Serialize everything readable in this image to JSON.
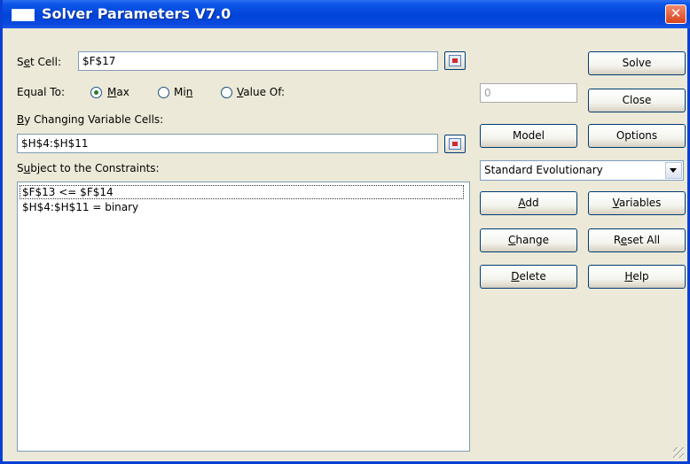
{
  "window": {
    "title": "Solver Parameters V7.0",
    "close_glyph": "✕"
  },
  "set_cell": {
    "label_pre": "S",
    "label_u": "e",
    "label_post": "t Cell:",
    "value": "$F$17"
  },
  "equal_to": {
    "label": "Equal To:",
    "options": [
      {
        "u": "M",
        "rest": "ax",
        "selected": true
      },
      {
        "pre": "Mi",
        "u": "n",
        "selected": false
      },
      {
        "pre": "",
        "u": "V",
        "rest": "alue Of:",
        "selected": false
      }
    ],
    "value_of": "0"
  },
  "changing_cells": {
    "label_u": "B",
    "label_post": "y Changing Variable Cells:",
    "value": "$H$4:$H$11"
  },
  "constraints": {
    "label_pre": "S",
    "label_u": "u",
    "label_post": "bject to the Constraints:",
    "items": [
      "$F$13 <= $F$14",
      "$H$4:$H$11 = binary"
    ]
  },
  "engine": {
    "selected": "Standard Evolutionary"
  },
  "buttons": {
    "solve": "Solve",
    "close": "Close",
    "model": "Model",
    "options": "Options",
    "add_u": "A",
    "add_rest": "dd",
    "variables_u": "V",
    "variables_rest": "ariables",
    "change_u": "C",
    "change_rest": "hange",
    "reset_pre": "R",
    "reset_u": "e",
    "reset_rest": "set All",
    "delete_u": "D",
    "delete_rest": "elete",
    "help_u": "H",
    "help_rest": "elp"
  },
  "colors": {
    "titlebar": "#0044d8",
    "dialog_bg": "#ece9d8",
    "close_button": "#d8431c"
  },
  "icons": {
    "title": "window-icon",
    "ref": "range-select-icon",
    "dropdown": "chevron-down-icon"
  }
}
